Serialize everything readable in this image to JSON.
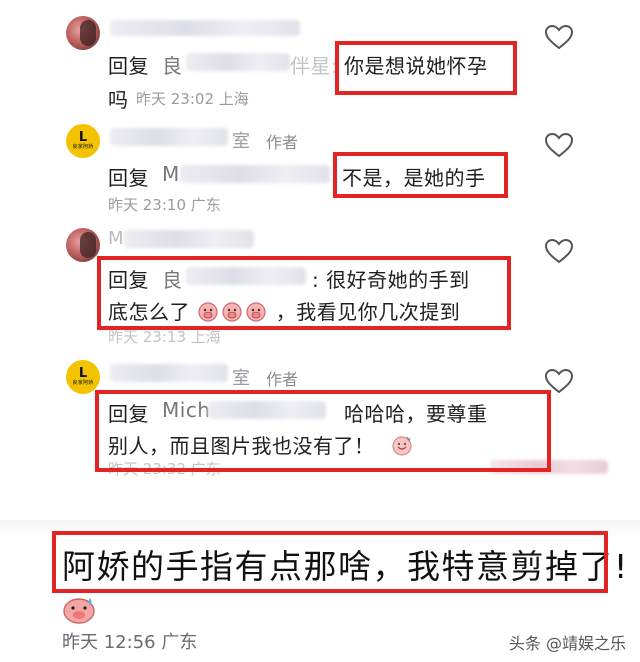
{
  "comments": [
    {
      "reply_prefix": "回复",
      "reply_target_initial": "良",
      "reply_target_tail": "伴星:",
      "reply_text_line1": "你是想说她怀孕",
      "reply_text_line2": "吗",
      "time": "昨天 23:02 上海",
      "like_icon": "heart-outline-icon"
    },
    {
      "avatar_logo_letter": "L",
      "avatar_logo_sub": "良家阿娇",
      "name_tail": "室",
      "author_tag": "作者",
      "reply_prefix": "回复",
      "reply_target_initial": "M",
      "reply_text": "不是，是她的手",
      "time": "昨天 23:10 广东",
      "like_icon": "heart-outline-icon"
    },
    {
      "name_initial": "M",
      "reply_prefix": "回复",
      "reply_target_initial": "良",
      "reply_text_line1": ":  很好奇她的手到",
      "reply_text_line2_prefix": "底怎么了",
      "reply_text_line2_suffix": "，我看见你几次提到",
      "time": "昨天 23:13 上海",
      "like_icon": "heart-outline-icon"
    },
    {
      "avatar_logo_letter": "L",
      "avatar_logo_sub": "良家阿娇",
      "name_tail": "室",
      "author_tag": "作者",
      "reply_prefix": "回复",
      "reply_target_initial": "Mich",
      "reply_text_line1": "哈哈哈，要尊重",
      "reply_text_line2": "别人，而且图片我也没有了！",
      "time": "昨天 23:32 广东",
      "like_icon": "heart-outline-icon"
    }
  ],
  "highlight": {
    "text": "阿娇的手指有点那啥，我特意剪掉了!",
    "time": "昨天 12:56 广东"
  },
  "watermark": "头条 @靖娱之乐",
  "colors": {
    "highlight_box": "#e32424",
    "meta_text": "#9a9aa3",
    "logo_bg": "#f3c300"
  }
}
